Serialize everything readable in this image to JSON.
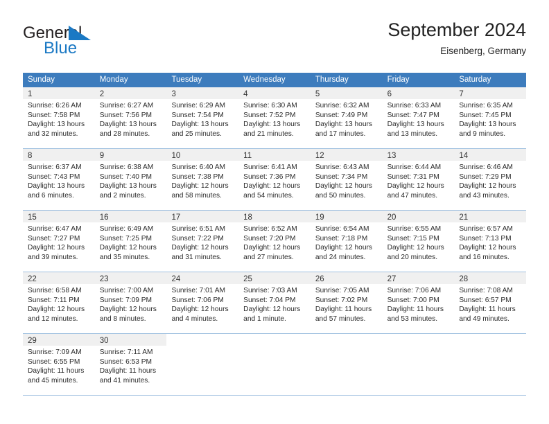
{
  "brand": {
    "name_part1": "General",
    "name_part2": "Blue",
    "mark_icon": "blue-triangle-flag-icon",
    "colors": {
      "accent": "#1b79c4",
      "header_blue": "#3d7cbd",
      "band_gray": "#f0f0f0",
      "grid_line": "#9dbfdf"
    }
  },
  "header": {
    "title": "September 2024",
    "subtitle": "Eisenberg, Germany"
  },
  "calendar": {
    "weekday_headers": [
      "Sunday",
      "Monday",
      "Tuesday",
      "Wednesday",
      "Thursday",
      "Friday",
      "Saturday"
    ],
    "weeks": [
      [
        {
          "day": "1",
          "sunrise": "Sunrise: 6:26 AM",
          "sunset": "Sunset: 7:58 PM",
          "daylight_1": "Daylight: 13 hours",
          "daylight_2": "and 32 minutes."
        },
        {
          "day": "2",
          "sunrise": "Sunrise: 6:27 AM",
          "sunset": "Sunset: 7:56 PM",
          "daylight_1": "Daylight: 13 hours",
          "daylight_2": "and 28 minutes."
        },
        {
          "day": "3",
          "sunrise": "Sunrise: 6:29 AM",
          "sunset": "Sunset: 7:54 PM",
          "daylight_1": "Daylight: 13 hours",
          "daylight_2": "and 25 minutes."
        },
        {
          "day": "4",
          "sunrise": "Sunrise: 6:30 AM",
          "sunset": "Sunset: 7:52 PM",
          "daylight_1": "Daylight: 13 hours",
          "daylight_2": "and 21 minutes."
        },
        {
          "day": "5",
          "sunrise": "Sunrise: 6:32 AM",
          "sunset": "Sunset: 7:49 PM",
          "daylight_1": "Daylight: 13 hours",
          "daylight_2": "and 17 minutes."
        },
        {
          "day": "6",
          "sunrise": "Sunrise: 6:33 AM",
          "sunset": "Sunset: 7:47 PM",
          "daylight_1": "Daylight: 13 hours",
          "daylight_2": "and 13 minutes."
        },
        {
          "day": "7",
          "sunrise": "Sunrise: 6:35 AM",
          "sunset": "Sunset: 7:45 PM",
          "daylight_1": "Daylight: 13 hours",
          "daylight_2": "and 9 minutes."
        }
      ],
      [
        {
          "day": "8",
          "sunrise": "Sunrise: 6:37 AM",
          "sunset": "Sunset: 7:43 PM",
          "daylight_1": "Daylight: 13 hours",
          "daylight_2": "and 6 minutes."
        },
        {
          "day": "9",
          "sunrise": "Sunrise: 6:38 AM",
          "sunset": "Sunset: 7:40 PM",
          "daylight_1": "Daylight: 13 hours",
          "daylight_2": "and 2 minutes."
        },
        {
          "day": "10",
          "sunrise": "Sunrise: 6:40 AM",
          "sunset": "Sunset: 7:38 PM",
          "daylight_1": "Daylight: 12 hours",
          "daylight_2": "and 58 minutes."
        },
        {
          "day": "11",
          "sunrise": "Sunrise: 6:41 AM",
          "sunset": "Sunset: 7:36 PM",
          "daylight_1": "Daylight: 12 hours",
          "daylight_2": "and 54 minutes."
        },
        {
          "day": "12",
          "sunrise": "Sunrise: 6:43 AM",
          "sunset": "Sunset: 7:34 PM",
          "daylight_1": "Daylight: 12 hours",
          "daylight_2": "and 50 minutes."
        },
        {
          "day": "13",
          "sunrise": "Sunrise: 6:44 AM",
          "sunset": "Sunset: 7:31 PM",
          "daylight_1": "Daylight: 12 hours",
          "daylight_2": "and 47 minutes."
        },
        {
          "day": "14",
          "sunrise": "Sunrise: 6:46 AM",
          "sunset": "Sunset: 7:29 PM",
          "daylight_1": "Daylight: 12 hours",
          "daylight_2": "and 43 minutes."
        }
      ],
      [
        {
          "day": "15",
          "sunrise": "Sunrise: 6:47 AM",
          "sunset": "Sunset: 7:27 PM",
          "daylight_1": "Daylight: 12 hours",
          "daylight_2": "and 39 minutes."
        },
        {
          "day": "16",
          "sunrise": "Sunrise: 6:49 AM",
          "sunset": "Sunset: 7:25 PM",
          "daylight_1": "Daylight: 12 hours",
          "daylight_2": "and 35 minutes."
        },
        {
          "day": "17",
          "sunrise": "Sunrise: 6:51 AM",
          "sunset": "Sunset: 7:22 PM",
          "daylight_1": "Daylight: 12 hours",
          "daylight_2": "and 31 minutes."
        },
        {
          "day": "18",
          "sunrise": "Sunrise: 6:52 AM",
          "sunset": "Sunset: 7:20 PM",
          "daylight_1": "Daylight: 12 hours",
          "daylight_2": "and 27 minutes."
        },
        {
          "day": "19",
          "sunrise": "Sunrise: 6:54 AM",
          "sunset": "Sunset: 7:18 PM",
          "daylight_1": "Daylight: 12 hours",
          "daylight_2": "and 24 minutes."
        },
        {
          "day": "20",
          "sunrise": "Sunrise: 6:55 AM",
          "sunset": "Sunset: 7:15 PM",
          "daylight_1": "Daylight: 12 hours",
          "daylight_2": "and 20 minutes."
        },
        {
          "day": "21",
          "sunrise": "Sunrise: 6:57 AM",
          "sunset": "Sunset: 7:13 PM",
          "daylight_1": "Daylight: 12 hours",
          "daylight_2": "and 16 minutes."
        }
      ],
      [
        {
          "day": "22",
          "sunrise": "Sunrise: 6:58 AM",
          "sunset": "Sunset: 7:11 PM",
          "daylight_1": "Daylight: 12 hours",
          "daylight_2": "and 12 minutes."
        },
        {
          "day": "23",
          "sunrise": "Sunrise: 7:00 AM",
          "sunset": "Sunset: 7:09 PM",
          "daylight_1": "Daylight: 12 hours",
          "daylight_2": "and 8 minutes."
        },
        {
          "day": "24",
          "sunrise": "Sunrise: 7:01 AM",
          "sunset": "Sunset: 7:06 PM",
          "daylight_1": "Daylight: 12 hours",
          "daylight_2": "and 4 minutes."
        },
        {
          "day": "25",
          "sunrise": "Sunrise: 7:03 AM",
          "sunset": "Sunset: 7:04 PM",
          "daylight_1": "Daylight: 12 hours",
          "daylight_2": "and 1 minute."
        },
        {
          "day": "26",
          "sunrise": "Sunrise: 7:05 AM",
          "sunset": "Sunset: 7:02 PM",
          "daylight_1": "Daylight: 11 hours",
          "daylight_2": "and 57 minutes."
        },
        {
          "day": "27",
          "sunrise": "Sunrise: 7:06 AM",
          "sunset": "Sunset: 7:00 PM",
          "daylight_1": "Daylight: 11 hours",
          "daylight_2": "and 53 minutes."
        },
        {
          "day": "28",
          "sunrise": "Sunrise: 7:08 AM",
          "sunset": "Sunset: 6:57 PM",
          "daylight_1": "Daylight: 11 hours",
          "daylight_2": "and 49 minutes."
        }
      ],
      [
        {
          "day": "29",
          "sunrise": "Sunrise: 7:09 AM",
          "sunset": "Sunset: 6:55 PM",
          "daylight_1": "Daylight: 11 hours",
          "daylight_2": "and 45 minutes."
        },
        {
          "day": "30",
          "sunrise": "Sunrise: 7:11 AM",
          "sunset": "Sunset: 6:53 PM",
          "daylight_1": "Daylight: 11 hours",
          "daylight_2": "and 41 minutes."
        },
        {
          "day": "",
          "sunrise": "",
          "sunset": "",
          "daylight_1": "",
          "daylight_2": ""
        },
        {
          "day": "",
          "sunrise": "",
          "sunset": "",
          "daylight_1": "",
          "daylight_2": ""
        },
        {
          "day": "",
          "sunrise": "",
          "sunset": "",
          "daylight_1": "",
          "daylight_2": ""
        },
        {
          "day": "",
          "sunrise": "",
          "sunset": "",
          "daylight_1": "",
          "daylight_2": ""
        },
        {
          "day": "",
          "sunrise": "",
          "sunset": "",
          "daylight_1": "",
          "daylight_2": ""
        }
      ]
    ]
  }
}
